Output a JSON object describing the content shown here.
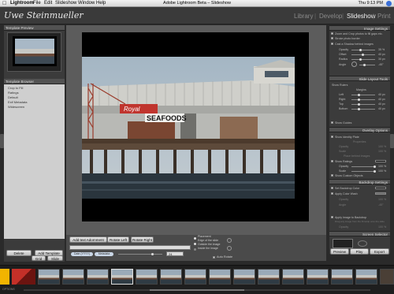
{
  "menubar": {
    "app": "Lightroom",
    "items": [
      "File",
      "Edit",
      "Slideshow",
      "Window",
      "Help"
    ],
    "title": "Adobe Lightroom Beta – Slideshow",
    "clock": "Thu 9:13 PM"
  },
  "identity": {
    "plate": "Uwe Steinmueller",
    "modules": [
      "Library",
      "Develop",
      "Slideshow",
      "Print"
    ],
    "active_module": "Slideshow"
  },
  "left": {
    "preview_header": "Template Preview",
    "browser_header": "Template Browser",
    "templates": [
      "Crop to Fill",
      "Ratings",
      "Default",
      "Exif Metadata",
      "Widescreen"
    ],
    "delete_button": "Delete",
    "add_button": "Add Template"
  },
  "photo": {
    "sign_seafoods": "SEAFOODS",
    "sign_royal": "Royal"
  },
  "toolbar": {
    "add_text": "Add text Adornment",
    "rotate_left": "Rotate Left",
    "rotate_right": "Rotate Right",
    "tag1": "Date (YYYY)",
    "tag2": "Metadata",
    "font_size": "24",
    "placement_title": "Placement",
    "placement_opts": [
      "Edge of the slide",
      "Outside the image",
      "Inside the image"
    ],
    "auto_rotate": "Auto Rotate"
  },
  "right": {
    "image_settings": "Image Settings",
    "zoom_crop": "Zoom and Crop photos to fill gaps etc.",
    "stroke": "Stroke photo border",
    "cast_shadow": "Cast a Shadow behind images",
    "shadow_rows": [
      "Opacity",
      "Offset",
      "Radius",
      "Angle"
    ],
    "shadow_vals": [
      "35 %",
      "40 px",
      "30 px",
      "-45°"
    ],
    "layout_tools": "Slide Layout Tools",
    "show_rulers": "Show Rulers",
    "margins_label": "Margins",
    "margins": [
      "Left",
      "Right",
      "Top",
      "Bottom"
    ],
    "margin_vals": [
      "40 px",
      "40 px",
      "40 px",
      "40 px"
    ],
    "show_guides": "Show Guides",
    "overlay_options": "Overlay Options",
    "show_identity": "Show Identity Plate",
    "properties": "Properties",
    "identity_rows": [
      "Opacity",
      "Scale"
    ],
    "identity_vals": [
      "100 %",
      "100 %"
    ],
    "place_behind": "Place behind images",
    "show_ratings": "Show Ratings",
    "ratings_rows": [
      "Opacity",
      "Scale"
    ],
    "ratings_vals": [
      "100 %",
      "100 %"
    ],
    "show_custom": "Show Custom Objects",
    "backdrop": "Backdrop Settings",
    "set_backdrop": "Set Backdrop Color",
    "apply_wash": "Apply Color Wash",
    "wash_rows": [
      "Opacity",
      "Angle"
    ],
    "wash_vals": [
      "100 %",
      "-45°"
    ],
    "apply_image": "Apply Image to Backdrop",
    "drag_hint": "Drag any image from the filmstrip onto the slide",
    "bg_opacity": "Opacity",
    "bg_opacity_val": "100 %",
    "screen_selector": "Screen Selector",
    "preview": "Preview",
    "play": "Play",
    "export": "Export"
  },
  "bottombar": {
    "grid": "Grid",
    "slide": "Slide",
    "options": "OPTIONS"
  },
  "colors": {
    "frame": "#000000",
    "panel": "#3b3b3b",
    "shelf": "#5c5c5c",
    "sign_red": "#c0352e"
  }
}
